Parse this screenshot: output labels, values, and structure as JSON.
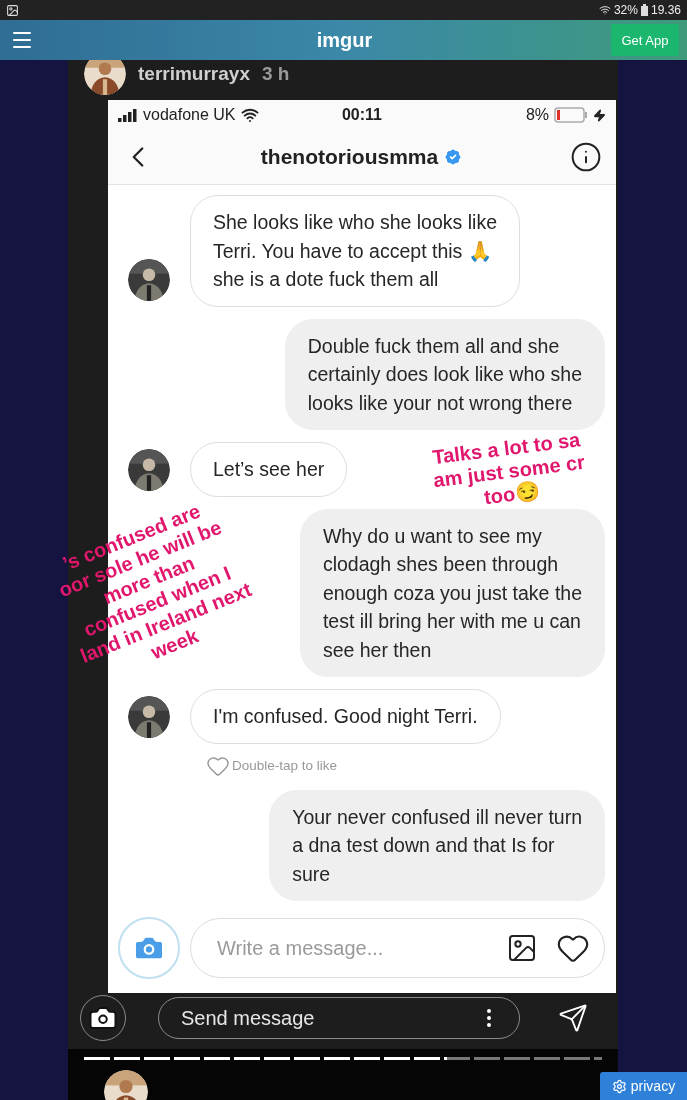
{
  "status_bar": {
    "battery": "32%",
    "time": "19.36"
  },
  "header": {
    "logo": "imgur",
    "get_app": "Get App"
  },
  "story": {
    "user": "terrimurrayx",
    "age": "3 h"
  },
  "phone_status": {
    "carrier": "vodafone UK",
    "time": "00:11",
    "battery": "8%"
  },
  "chat": {
    "title": "thenotoriousmma",
    "verified": true,
    "messages": [
      {
        "kind": "received",
        "text": "She looks like who she looks like\nTerri. You have to accept this 🙏\nshe is a dote fuck them all"
      },
      {
        "kind": "sent",
        "text": "Double fuck them all and she\ncertainly does look like who she\nlooks like your not wrong there"
      },
      {
        "kind": "received",
        "text": "Let’s see her"
      },
      {
        "kind": "sent",
        "text": "Why do u want to see my\nclodagh shes been through\nenough coza you just take the\ntest ill bring her with me u can\nsee her then"
      },
      {
        "kind": "received",
        "text": "I'm confused. Good night Terri.",
        "hint": "Double-tap to like"
      },
      {
        "kind": "sent",
        "text": "Your never confused ill never turn\na dna test down and that Is for\nsure"
      }
    ],
    "composer": {
      "placeholder": "Write a message..."
    }
  },
  "stickers": [
    {
      "text": "Talks a lot to sa\nam just some cr\ntoo😏"
    },
    {
      "text": "’s confused are\noor sole he will be\nmore than\nconfused when I\nland in Ireland next\nweek"
    }
  ],
  "story_footer": {
    "placeholder": "Send message"
  },
  "next_story": {
    "progress": {
      "level": 0.7
    }
  },
  "privacy_button": "privacy"
}
